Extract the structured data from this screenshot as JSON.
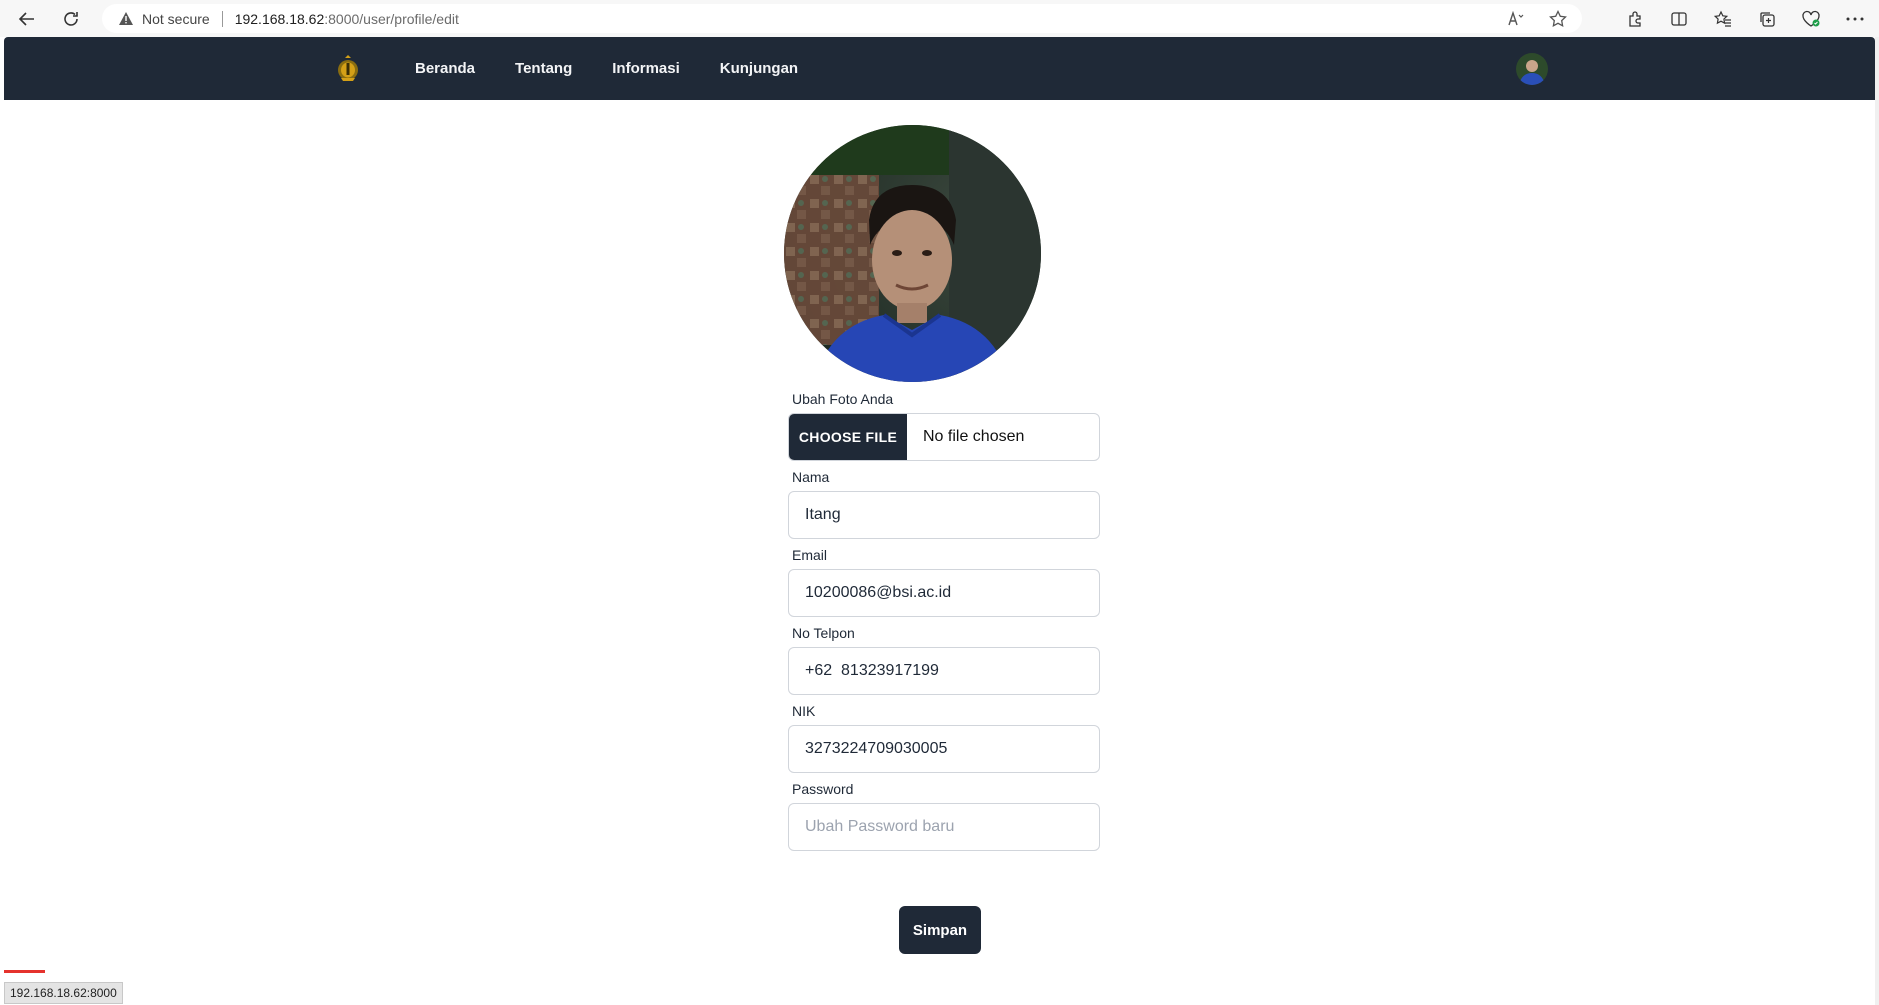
{
  "browser": {
    "security_label": "Not secure",
    "url_host": "192.168.18.62",
    "url_path": ":8000/user/profile/edit",
    "status_url": "192.168.18.62:8000"
  },
  "navbar": {
    "items": [
      "Beranda",
      "Tentang",
      "Informasi",
      "Kunjungan"
    ]
  },
  "form": {
    "photo_label": "Ubah Foto Anda",
    "file_button": "CHOOSE FILE",
    "file_status": "No file chosen",
    "name_label": "Nama",
    "name_value": "Itang",
    "email_label": "Email",
    "email_value": "10200086@bsi.ac.id",
    "phone_label": "No Telpon",
    "phone_value": "+62  81323917199",
    "nik_label": "NIK",
    "nik_value": "3273224709030005",
    "password_label": "Password",
    "password_placeholder": "Ubah Password baru",
    "submit_label": "Simpan"
  },
  "colors": {
    "navbar_bg": "#1f2937",
    "button_bg": "#1f2937"
  }
}
